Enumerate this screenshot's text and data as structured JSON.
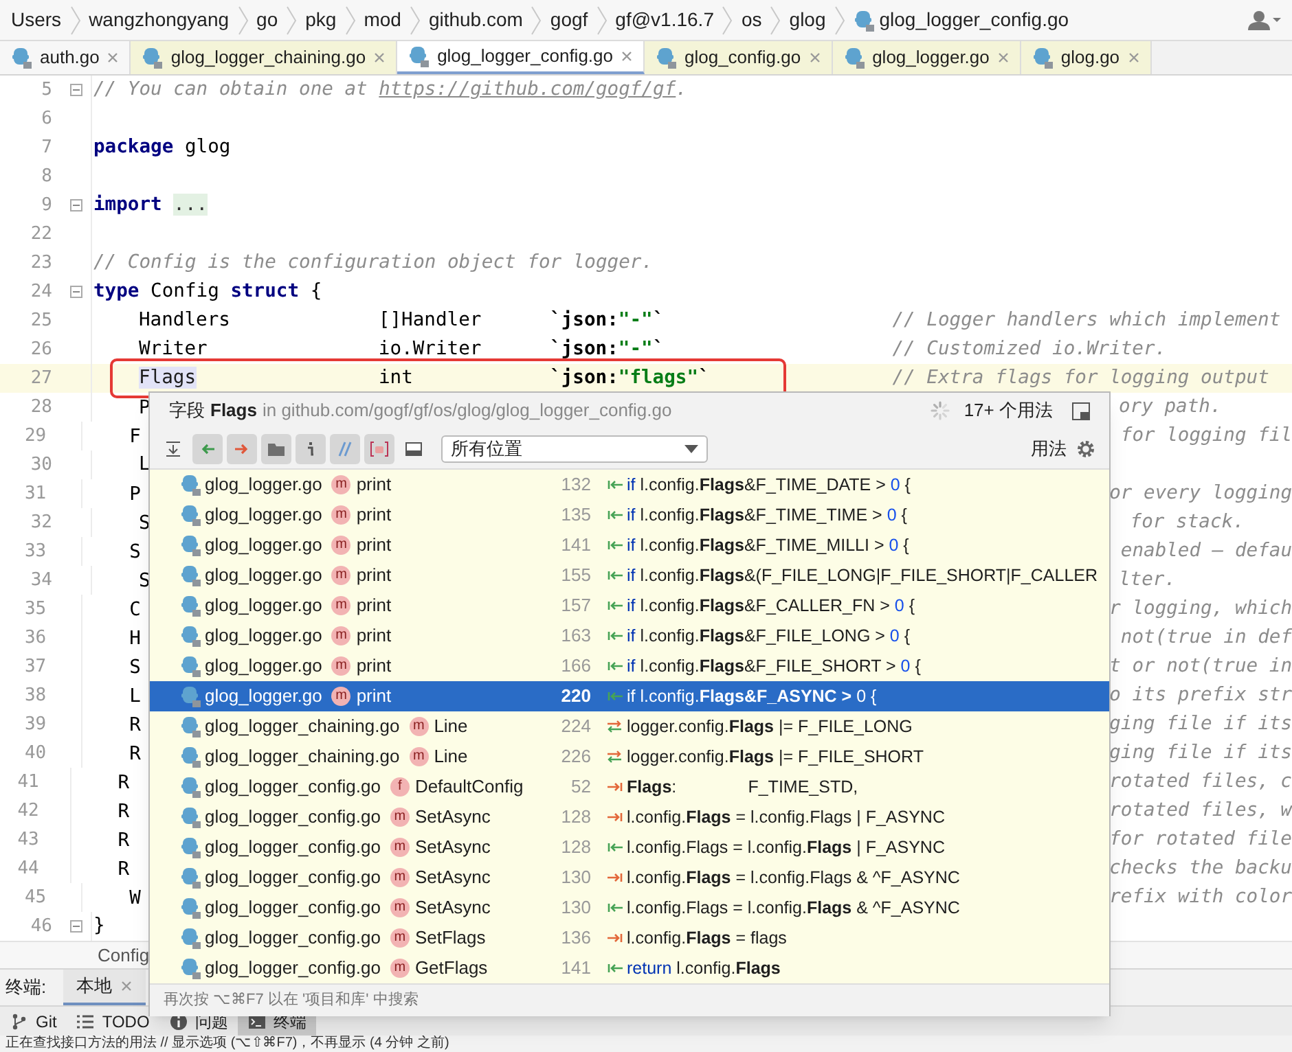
{
  "breadcrumb": [
    "Users",
    "wangzhongyang",
    "go",
    "pkg",
    "mod",
    "github.com",
    "gogf",
    "gf@v1.16.7",
    "os",
    "glog",
    "glog_logger_config.go"
  ],
  "tabs": [
    {
      "label": "auth.go",
      "selected": false,
      "library": false
    },
    {
      "label": "glog_logger_chaining.go",
      "selected": false,
      "library": true
    },
    {
      "label": "glog_logger_config.go",
      "selected": true,
      "library": false
    },
    {
      "label": "glog_config.go",
      "selected": false,
      "library": true
    },
    {
      "label": "glog_logger.go",
      "selected": false,
      "library": true
    },
    {
      "label": "glog.go",
      "selected": false,
      "library": true
    }
  ],
  "editor": {
    "lines": [
      {
        "number": "5",
        "fold": true,
        "current": false,
        "indented": false,
        "tokens": [
          {
            "kind": "comment",
            "text": "// You can obtain one at "
          },
          {
            "kind": "link",
            "text": "https://github.com/gogf/gf"
          },
          {
            "kind": "comment",
            "text": "."
          }
        ]
      },
      {
        "number": "6",
        "fold": false,
        "current": false
      },
      {
        "number": "7",
        "fold": false,
        "current": false,
        "indented": false,
        "tokens": [
          {
            "kind": "keyword",
            "text": "package"
          },
          {
            "kind": "plain",
            "text": " glog"
          }
        ]
      },
      {
        "number": "8",
        "fold": false,
        "current": false
      },
      {
        "number": "9",
        "fold": true,
        "current": false,
        "indented": false,
        "tokens": [
          {
            "kind": "keyword",
            "text": "import "
          },
          {
            "kind": "folded",
            "text": "..."
          }
        ]
      },
      {
        "number": "22",
        "fold": false,
        "current": false
      },
      {
        "number": "23",
        "fold": false,
        "current": false,
        "indented": false,
        "tokens": [
          {
            "kind": "comment",
            "text": "// Config is the configuration object for logger."
          }
        ]
      },
      {
        "number": "24",
        "fold": true,
        "current": false,
        "indented": false,
        "tokens": [
          {
            "kind": "keyword",
            "text": "type"
          },
          {
            "kind": "plain",
            "text": " Config "
          },
          {
            "kind": "keyword",
            "text": "struct"
          },
          {
            "kind": "plain",
            "text": " {"
          }
        ]
      },
      {
        "number": "25",
        "fold": false,
        "current": false,
        "indented": true,
        "tokens": [
          {
            "kind": "plain",
            "text": "Handlers             []Handler      "
          },
          {
            "kind": "tag",
            "text": "`json:"
          },
          {
            "kind": "string",
            "text": "\"-\""
          },
          {
            "kind": "tag",
            "text": "`                    "
          },
          {
            "kind": "comment",
            "text": "// Logger handlers which implement"
          }
        ]
      },
      {
        "number": "26",
        "fold": false,
        "current": false,
        "indented": true,
        "tokens": [
          {
            "kind": "plain",
            "text": "Writer               io.Writer      "
          },
          {
            "kind": "tag",
            "text": "`json:"
          },
          {
            "kind": "string",
            "text": "\"-\""
          },
          {
            "kind": "tag",
            "text": "`                    "
          },
          {
            "kind": "comment",
            "text": "// Customized io.Writer."
          }
        ]
      },
      {
        "number": "27",
        "fold": false,
        "current": true,
        "indented": true,
        "tokens": [
          {
            "kind": "highlighted",
            "text": "Flags"
          },
          {
            "kind": "plain",
            "text": "                int            "
          },
          {
            "kind": "tag",
            "text": "`json:"
          },
          {
            "kind": "string",
            "text": "\"flags\""
          },
          {
            "kind": "tag",
            "text": "`                "
          },
          {
            "kind": "comment",
            "text": "// Extra flags for logging output"
          }
        ]
      },
      {
        "number": "28",
        "fold": false,
        "current": false,
        "indented": true,
        "tokens": [
          {
            "kind": "plain",
            "text": "P"
          }
        ],
        "tail": "ory path."
      },
      {
        "number": "29",
        "fold": false,
        "current": false,
        "indented": true,
        "tokens": [
          {
            "kind": "plain",
            "text": "F"
          }
        ],
        "tail": " for logging fil"
      },
      {
        "number": "30",
        "fold": false,
        "current": false,
        "indented": true,
        "tokens": [
          {
            "kind": "plain",
            "text": "L"
          }
        ]
      },
      {
        "number": "31",
        "fold": false,
        "current": false,
        "indented": true,
        "tokens": [
          {
            "kind": "plain",
            "text": "P"
          }
        ],
        "tail": "or every logging"
      },
      {
        "number": "32",
        "fold": false,
        "current": false,
        "indented": true,
        "tokens": [
          {
            "kind": "plain",
            "text": "S"
          }
        ],
        "tail": " for stack."
      },
      {
        "number": "33",
        "fold": false,
        "current": false,
        "indented": true,
        "tokens": [
          {
            "kind": "plain",
            "text": "S"
          }
        ],
        "tail": " enabled – defau"
      },
      {
        "number": "34",
        "fold": false,
        "current": false,
        "indented": true,
        "tokens": [
          {
            "kind": "plain",
            "text": "S"
          }
        ],
        "tail": "lter."
      },
      {
        "number": "35",
        "fold": false,
        "current": false,
        "indented": true,
        "tokens": [
          {
            "kind": "plain",
            "text": "C"
          }
        ],
        "tail": "r logging, which"
      },
      {
        "number": "36",
        "fold": false,
        "current": false,
        "indented": true,
        "tokens": [
          {
            "kind": "plain",
            "text": "H"
          }
        ],
        "tail": " not(true in def"
      },
      {
        "number": "37",
        "fold": false,
        "current": false,
        "indented": true,
        "tokens": [
          {
            "kind": "plain",
            "text": "S"
          }
        ],
        "tail": "t or not(true in"
      },
      {
        "number": "38",
        "fold": false,
        "current": false,
        "indented": true,
        "tokens": [
          {
            "kind": "plain",
            "text": "L"
          }
        ],
        "tail": "o its prefix str"
      },
      {
        "number": "39",
        "fold": false,
        "current": false,
        "indented": true,
        "tokens": [
          {
            "kind": "plain",
            "text": "R"
          }
        ],
        "tail": "ging file if its"
      },
      {
        "number": "40",
        "fold": false,
        "current": false,
        "indented": true,
        "tokens": [
          {
            "kind": "plain",
            "text": "R"
          }
        ],
        "tail": "ging file if its"
      },
      {
        "number": "41",
        "fold": false,
        "current": false,
        "indented": true,
        "tokens": [
          {
            "kind": "plain",
            "text": "R"
          }
        ],
        "tail": " rotated files, c"
      },
      {
        "number": "42",
        "fold": false,
        "current": false,
        "indented": true,
        "tokens": [
          {
            "kind": "plain",
            "text": "R"
          }
        ],
        "tail": " rotated files, w"
      },
      {
        "number": "43",
        "fold": false,
        "current": false,
        "indented": true,
        "tokens": [
          {
            "kind": "plain",
            "text": "R"
          }
        ],
        "tail": " for rotated file"
      },
      {
        "number": "44",
        "fold": false,
        "current": false,
        "indented": true,
        "tokens": [
          {
            "kind": "plain",
            "text": "R"
          }
        ],
        "tail": " checks the backu"
      },
      {
        "number": "45",
        "fold": false,
        "current": false,
        "indented": true,
        "tokens": [
          {
            "kind": "plain",
            "text": "W"
          }
        ],
        "tail": "refix with color"
      },
      {
        "number": "46",
        "fold": true,
        "current": false,
        "indented": false,
        "tokens": [
          {
            "kind": "plain",
            "text": "}"
          }
        ]
      }
    ],
    "structure_breadcrumb": "Config"
  },
  "usages_popup": {
    "kind_label": "字段",
    "name": "Flags",
    "location": "in github.com/gogf/gf/os/glog/glog_logger_config.go",
    "count": "17+ 个用法",
    "toolbar": [
      {
        "kind": "expand",
        "on": false
      },
      {
        "kind": "read",
        "on": true
      },
      {
        "kind": "write",
        "on": true
      },
      {
        "kind": "module",
        "on": true
      },
      {
        "kind": "info",
        "on": true
      },
      {
        "kind": "comment",
        "on": true
      },
      {
        "kind": "method",
        "on": true
      },
      {
        "kind": "preview",
        "on": false
      }
    ],
    "scope": "所有位置",
    "group_label": "用法",
    "rows": [
      {
        "file": "glog_logger.go",
        "badge": "m",
        "member": "print",
        "line": "132",
        "kind": "read",
        "selected": false,
        "code": [
          {
            "kind": "keyword",
            "text": "if"
          },
          {
            "kind": "plain",
            "text": " l.config."
          },
          {
            "kind": "bold",
            "text": "Flags"
          },
          {
            "kind": "plain",
            "text": "&F_TIME_DATE > "
          },
          {
            "kind": "number",
            "text": "0"
          },
          {
            "kind": "plain",
            "text": " {"
          }
        ]
      },
      {
        "file": "glog_logger.go",
        "badge": "m",
        "member": "print",
        "line": "135",
        "kind": "read",
        "selected": false,
        "code": [
          {
            "kind": "keyword",
            "text": "if"
          },
          {
            "kind": "plain",
            "text": " l.config."
          },
          {
            "kind": "bold",
            "text": "Flags"
          },
          {
            "kind": "plain",
            "text": "&F_TIME_TIME > "
          },
          {
            "kind": "number",
            "text": "0"
          },
          {
            "kind": "plain",
            "text": " {"
          }
        ]
      },
      {
        "file": "glog_logger.go",
        "badge": "m",
        "member": "print",
        "line": "141",
        "kind": "read",
        "selected": false,
        "code": [
          {
            "kind": "keyword",
            "text": "if"
          },
          {
            "kind": "plain",
            "text": " l.config."
          },
          {
            "kind": "bold",
            "text": "Flags"
          },
          {
            "kind": "plain",
            "text": "&F_TIME_MILLI > "
          },
          {
            "kind": "number",
            "text": "0"
          },
          {
            "kind": "plain",
            "text": " {"
          }
        ]
      },
      {
        "file": "glog_logger.go",
        "badge": "m",
        "member": "print",
        "line": "155",
        "kind": "read",
        "selected": false,
        "code": [
          {
            "kind": "keyword",
            "text": "if"
          },
          {
            "kind": "plain",
            "text": " l.config."
          },
          {
            "kind": "bold",
            "text": "Flags"
          },
          {
            "kind": "plain",
            "text": "&(F_FILE_LONG|F_FILE_SHORT|F_CALLER"
          }
        ]
      },
      {
        "file": "glog_logger.go",
        "badge": "m",
        "member": "print",
        "line": "157",
        "kind": "read",
        "selected": false,
        "code": [
          {
            "kind": "keyword",
            "text": "if"
          },
          {
            "kind": "plain",
            "text": " l.config."
          },
          {
            "kind": "bold",
            "text": "Flags"
          },
          {
            "kind": "plain",
            "text": "&F_CALLER_FN > "
          },
          {
            "kind": "number",
            "text": "0"
          },
          {
            "kind": "plain",
            "text": " {"
          }
        ]
      },
      {
        "file": "glog_logger.go",
        "badge": "m",
        "member": "print",
        "line": "163",
        "kind": "read",
        "selected": false,
        "code": [
          {
            "kind": "keyword",
            "text": "if"
          },
          {
            "kind": "plain",
            "text": " l.config."
          },
          {
            "kind": "bold",
            "text": "Flags"
          },
          {
            "kind": "plain",
            "text": "&F_FILE_LONG > "
          },
          {
            "kind": "number",
            "text": "0"
          },
          {
            "kind": "plain",
            "text": " {"
          }
        ]
      },
      {
        "file": "glog_logger.go",
        "badge": "m",
        "member": "print",
        "line": "166",
        "kind": "read",
        "selected": false,
        "code": [
          {
            "kind": "keyword",
            "text": "if"
          },
          {
            "kind": "plain",
            "text": " l.config."
          },
          {
            "kind": "bold",
            "text": "Flags"
          },
          {
            "kind": "plain",
            "text": "&F_FILE_SHORT > "
          },
          {
            "kind": "number",
            "text": "0"
          },
          {
            "kind": "plain",
            "text": " {"
          }
        ]
      },
      {
        "file": "glog_logger.go",
        "badge": "m",
        "member": "print",
        "line": "220",
        "kind": "read",
        "selected": true,
        "code": [
          {
            "kind": "keyword",
            "text": "if"
          },
          {
            "kind": "plain",
            "text": " l.config."
          },
          {
            "kind": "bold",
            "text": "Flags"
          },
          {
            "kind": "bold",
            "text": "&F_ASYNC > "
          },
          {
            "kind": "number",
            "text": "0"
          },
          {
            "kind": "plain",
            "text": " {"
          }
        ]
      },
      {
        "file": "glog_logger_chaining.go",
        "badge": "m",
        "member": "Line",
        "line": "224",
        "kind": "read_write",
        "selected": false,
        "code": [
          {
            "kind": "plain",
            "text": "logger.config."
          },
          {
            "kind": "bold",
            "text": "Flags"
          },
          {
            "kind": "plain",
            "text": " |= F_FILE_LONG"
          }
        ]
      },
      {
        "file": "glog_logger_chaining.go",
        "badge": "m",
        "member": "Line",
        "line": "226",
        "kind": "read_write",
        "selected": false,
        "code": [
          {
            "kind": "plain",
            "text": "logger.config."
          },
          {
            "kind": "bold",
            "text": "Flags"
          },
          {
            "kind": "plain",
            "text": " |= F_FILE_SHORT"
          }
        ]
      },
      {
        "file": "glog_logger_config.go",
        "badge": "f",
        "member": "DefaultConfig",
        "line": "52",
        "kind": "write",
        "selected": false,
        "code": [
          {
            "kind": "bold",
            "text": "Flags"
          },
          {
            "kind": "plain",
            "text": ":               F_TIME_STD,"
          }
        ]
      },
      {
        "file": "glog_logger_config.go",
        "badge": "m",
        "member": "SetAsync",
        "line": "128",
        "kind": "write",
        "selected": false,
        "code": [
          {
            "kind": "plain",
            "text": "l.config."
          },
          {
            "kind": "bold",
            "text": "Flags"
          },
          {
            "kind": "plain",
            "text": " = l.config.Flags | F_ASYNC"
          }
        ]
      },
      {
        "file": "glog_logger_config.go",
        "badge": "m",
        "member": "SetAsync",
        "line": "128",
        "kind": "read",
        "selected": false,
        "code": [
          {
            "kind": "plain",
            "text": "l.config.Flags = l.config."
          },
          {
            "kind": "bold",
            "text": "Flags"
          },
          {
            "kind": "plain",
            "text": " | F_ASYNC"
          }
        ]
      },
      {
        "file": "glog_logger_config.go",
        "badge": "m",
        "member": "SetAsync",
        "line": "130",
        "kind": "write",
        "selected": false,
        "code": [
          {
            "kind": "plain",
            "text": "l.config."
          },
          {
            "kind": "bold",
            "text": "Flags"
          },
          {
            "kind": "plain",
            "text": " = l.config.Flags & ^F_ASYNC"
          }
        ]
      },
      {
        "file": "glog_logger_config.go",
        "badge": "m",
        "member": "SetAsync",
        "line": "130",
        "kind": "read",
        "selected": false,
        "code": [
          {
            "kind": "plain",
            "text": "l.config.Flags = l.config."
          },
          {
            "kind": "bold",
            "text": "Flags"
          },
          {
            "kind": "plain",
            "text": " & ^F_ASYNC"
          }
        ]
      },
      {
        "file": "glog_logger_config.go",
        "badge": "m",
        "member": "SetFlags",
        "line": "136",
        "kind": "write",
        "selected": false,
        "code": [
          {
            "kind": "plain",
            "text": "l.config."
          },
          {
            "kind": "bold",
            "text": "Flags"
          },
          {
            "kind": "plain",
            "text": " = flags"
          }
        ]
      },
      {
        "file": "glog_logger_config.go",
        "badge": "m",
        "member": "GetFlags",
        "line": "141",
        "kind": "read",
        "selected": false,
        "code": [
          {
            "kind": "keyword",
            "text": "return"
          },
          {
            "kind": "plain",
            "text": " l.config."
          },
          {
            "kind": "bold",
            "text": "Flags"
          }
        ]
      }
    ],
    "footer": "再次按 ⌥⌘F7 以在 '项目和库' 中搜索"
  },
  "terminal": {
    "label": "终端:",
    "tabs": [
      {
        "label": "本地",
        "selected": true
      }
    ]
  },
  "tool_windows": [
    {
      "kind": "vcs",
      "label": "Git",
      "selected": false
    },
    {
      "kind": "todo",
      "label": "TODO",
      "selected": false
    },
    {
      "kind": "problems",
      "label": "问题",
      "selected": false
    },
    {
      "kind": "terminal",
      "label": "终端",
      "selected": true
    }
  ],
  "status_bar": "正在查找接口方法的用法 // 显示选项 (⌥⇧⌘F7)，不再显示 (4 分钟 之前)"
}
